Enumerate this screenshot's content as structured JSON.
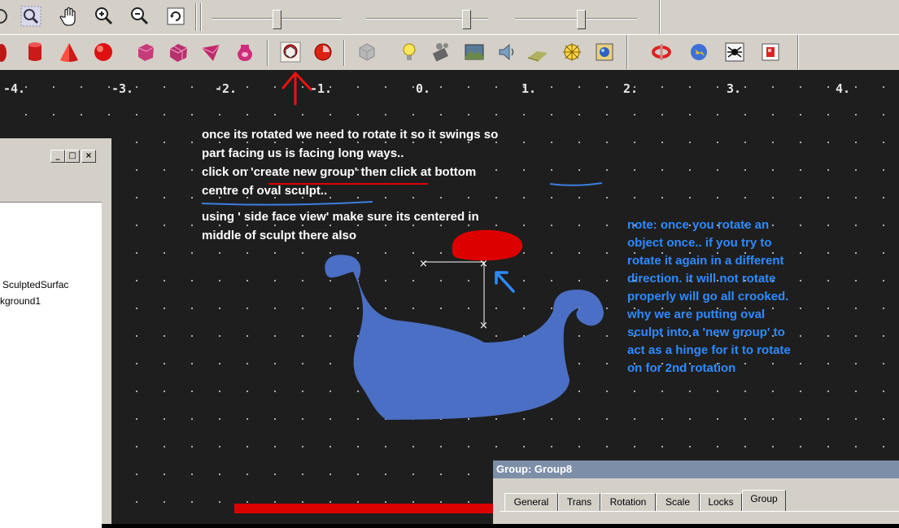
{
  "toolbar_top": {
    "icons": [
      "target-icon",
      "zoom-icon",
      "pan-hand-icon",
      "zoom-in-icon",
      "zoom-out-icon",
      "refresh-icon"
    ],
    "sliders": [
      {
        "name": "slider-1",
        "value": 0.5
      },
      {
        "name": "slider-2",
        "value": 0.85
      },
      {
        "name": "slider-3",
        "value": 0.55
      }
    ]
  },
  "toolbar_shapes": {
    "icons": [
      "cylinder-icon",
      "cone-icon",
      "sphere-icon",
      "box-icon",
      "box2-icon",
      "wedge-icon",
      "torus-icon",
      "create-new-group-icon",
      "create-group-2-icon",
      "group-gray-icon",
      "light-bulb-icon",
      "camera-icon",
      "background-icon",
      "sound-icon",
      "ground-icon",
      "compass-icon",
      "render-icon",
      "rotate-icon",
      "world-icon",
      "spider-icon",
      "box-red-icon"
    ]
  },
  "ruler": {
    "ticks": [
      "-4.",
      "-3.",
      "-2.",
      "-1.",
      "0.",
      "1.",
      "2.",
      "3.",
      "4."
    ]
  },
  "annotation_white": [
    "once its rotated we need to rotate it so it swings so",
    "part facing us is facing long ways..",
    "click on 'create new group' then click at bottom",
    "centre of oval sculpt..",
    "using ' side face view' make sure its centered in",
    "middle of sculpt there also"
  ],
  "annotation_blue": [
    "note: once you rotate an",
    "object once.. if you try to",
    "rotate it again in a different",
    "direction. it will not rotate",
    "properly will go all crooked.",
    "why we are putting oval",
    "sculpt into a 'new group' to",
    "act as a hinge for it to rotate",
    "on for 2nd rotation"
  ],
  "left_panel": {
    "window_buttons": [
      "_",
      "□",
      "×"
    ],
    "tree_items": [
      "SculptedSurfac",
      "kground1"
    ]
  },
  "dialog": {
    "title": "Group: Group8",
    "tabs": [
      "General",
      "Trans",
      "Rotation",
      "Scale",
      "Locks",
      "Group"
    ],
    "active_tab": "Group"
  },
  "colors": {
    "sleigh": "#4a6fc4",
    "oval": "#dd0000",
    "note_text": "#2e8bff",
    "arrow_red": "#ee1111",
    "arrow_blue": "#2e8bff",
    "underline_red": "#dd0000",
    "underline_blue": "#3b7fe0"
  }
}
